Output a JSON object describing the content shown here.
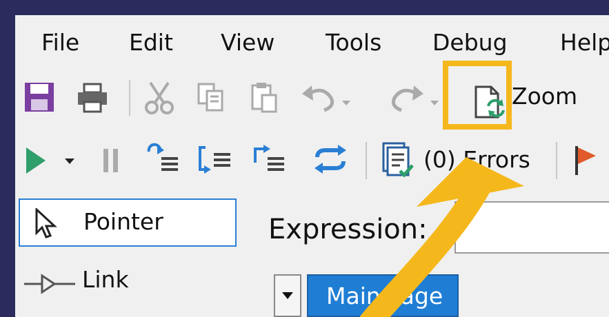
{
  "menu": {
    "file": "File",
    "edit": "Edit",
    "view": "View",
    "tools": "Tools",
    "debug": "Debug",
    "help": "Help"
  },
  "toolbar": {
    "zoom_label": "Zoom",
    "errors_label": "(0) Errors"
  },
  "toolbox": {
    "pointer_label": "Pointer",
    "link_label": "Link"
  },
  "editor": {
    "expression_label": "Expression:",
    "expression_value": "",
    "page_tab_label": "Main Page"
  },
  "colors": {
    "frame": "#2b2b5e",
    "highlight": "#f5b81c",
    "accent_blue": "#1f7ed4",
    "save_purple": "#7a3fa0",
    "play_green": "#2e9e6a"
  },
  "icons": [
    "save-icon",
    "print-icon",
    "cut-icon",
    "copy-icon",
    "paste-icon",
    "undo-icon",
    "redo-icon",
    "refresh-page-icon",
    "run-icon",
    "pause-icon",
    "step-into-icon",
    "step-over-icon",
    "step-out-icon",
    "restart-icon",
    "error-list-icon",
    "pointer-cursor-icon",
    "link-connector-icon"
  ]
}
